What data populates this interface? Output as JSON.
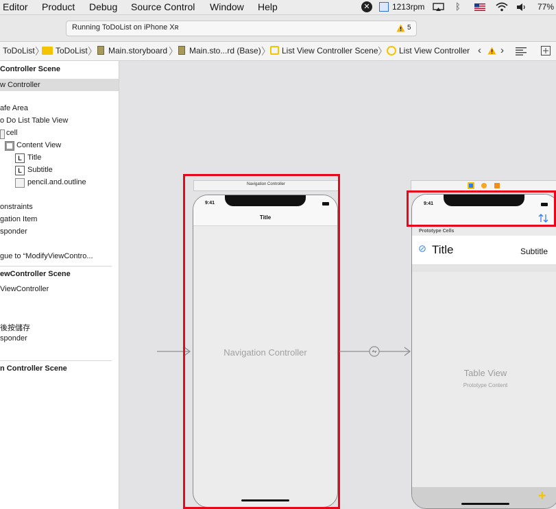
{
  "menubar": {
    "menus": [
      "Editor",
      "Product",
      "Debug",
      "Source Control",
      "Window",
      "Help"
    ],
    "rpm": "1213rpm",
    "battery": "77%"
  },
  "toolbar": {
    "activity_text": "Running ToDoList on iPhone Xʀ",
    "warning_count": "5"
  },
  "jumpbar": {
    "crumbs": [
      "ToDoList",
      "ToDoList",
      "Main.storyboard",
      "Main.sto...rd (Base)",
      "List View Controller Scene",
      "List View Controller"
    ]
  },
  "outline": {
    "items": [
      {
        "label": "Controller Scene",
        "bold": true
      },
      {
        "label": "w Controller",
        "selected": true
      },
      {
        "label": "afe Area"
      },
      {
        "label": "o Do List Table View"
      },
      {
        "label": "cell"
      },
      {
        "label": "Content View"
      },
      {
        "label": "Title"
      },
      {
        "label": "Subtitle"
      },
      {
        "label": "pencil.and.outline"
      },
      {
        "label": "onstraints"
      },
      {
        "label": "gation Item"
      },
      {
        "label": "sponder"
      },
      {
        "label": "gue to “ModifyViewContro..."
      },
      {
        "label": "ewController Scene",
        "bold": true
      },
      {
        "label": "ViewController"
      },
      {
        "label": "後按儲存"
      },
      {
        "label": "sponder"
      },
      {
        "label": "n Controller Scene",
        "bold": true
      }
    ]
  },
  "canvas": {
    "nav_controller": {
      "header_label": "Navigation Controller",
      "status_time": "9:41",
      "nav_title": "Title",
      "body_label": "Navigation Controller"
    },
    "list_controller": {
      "status_time": "9:41",
      "prototype_cells_label": "Prototype Cells",
      "cell_title": "Title",
      "cell_subtitle": "Subtitle",
      "table_label": "Table View",
      "table_sublabel": "Prototype Content"
    }
  },
  "colors": {
    "highlight": "#e8061a",
    "folder": "#f5c400",
    "warning": "#f5b400",
    "add": "#f5c400",
    "sort": "#2f7cf6"
  }
}
